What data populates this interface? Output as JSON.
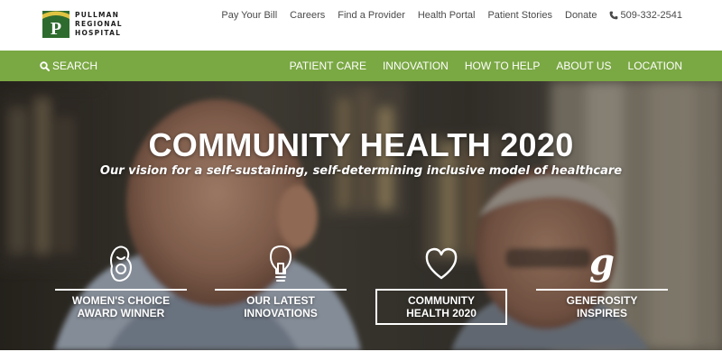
{
  "brand": {
    "name_lines": [
      "PULLMAN",
      "REGIONAL",
      "HOSPITAL"
    ],
    "logo_letter": "P",
    "colors": {
      "green": "#7aa843",
      "dark_green": "#2e6b2e",
      "gold": "#e0c341"
    }
  },
  "utility_nav": {
    "links": [
      "Pay Your Bill",
      "Careers",
      "Find a Provider",
      "Health Portal",
      "Patient Stories",
      "Donate"
    ],
    "phone": "509-332-2541",
    "phone_icon": "phone-icon"
  },
  "main_nav": {
    "search_label": "SEARCH",
    "search_icon": "search-icon",
    "items": [
      "PATIENT CARE",
      "INNOVATION",
      "HOW TO HELP",
      "ABOUT US",
      "LOCATION"
    ]
  },
  "hero": {
    "title": "COMMUNITY HEALTH 2020",
    "subtitle": "Our vision for a self-sustaining, self-determining inclusive model of healthcare"
  },
  "features": [
    {
      "icon": "mother-child-icon",
      "line1": "WOMEN'S CHOICE",
      "line2": "AWARD WINNER",
      "selected": false
    },
    {
      "icon": "lightbulb-icon",
      "line1": "OUR LATEST",
      "line2": "INNOVATIONS",
      "selected": false
    },
    {
      "icon": "heart-icon",
      "line1": "COMMUNITY",
      "line2": "HEALTH 2020",
      "selected": true
    },
    {
      "icon": "generosity-g-icon",
      "line1": "GENEROSITY",
      "line2": "INSPIRES",
      "selected": false
    }
  ]
}
